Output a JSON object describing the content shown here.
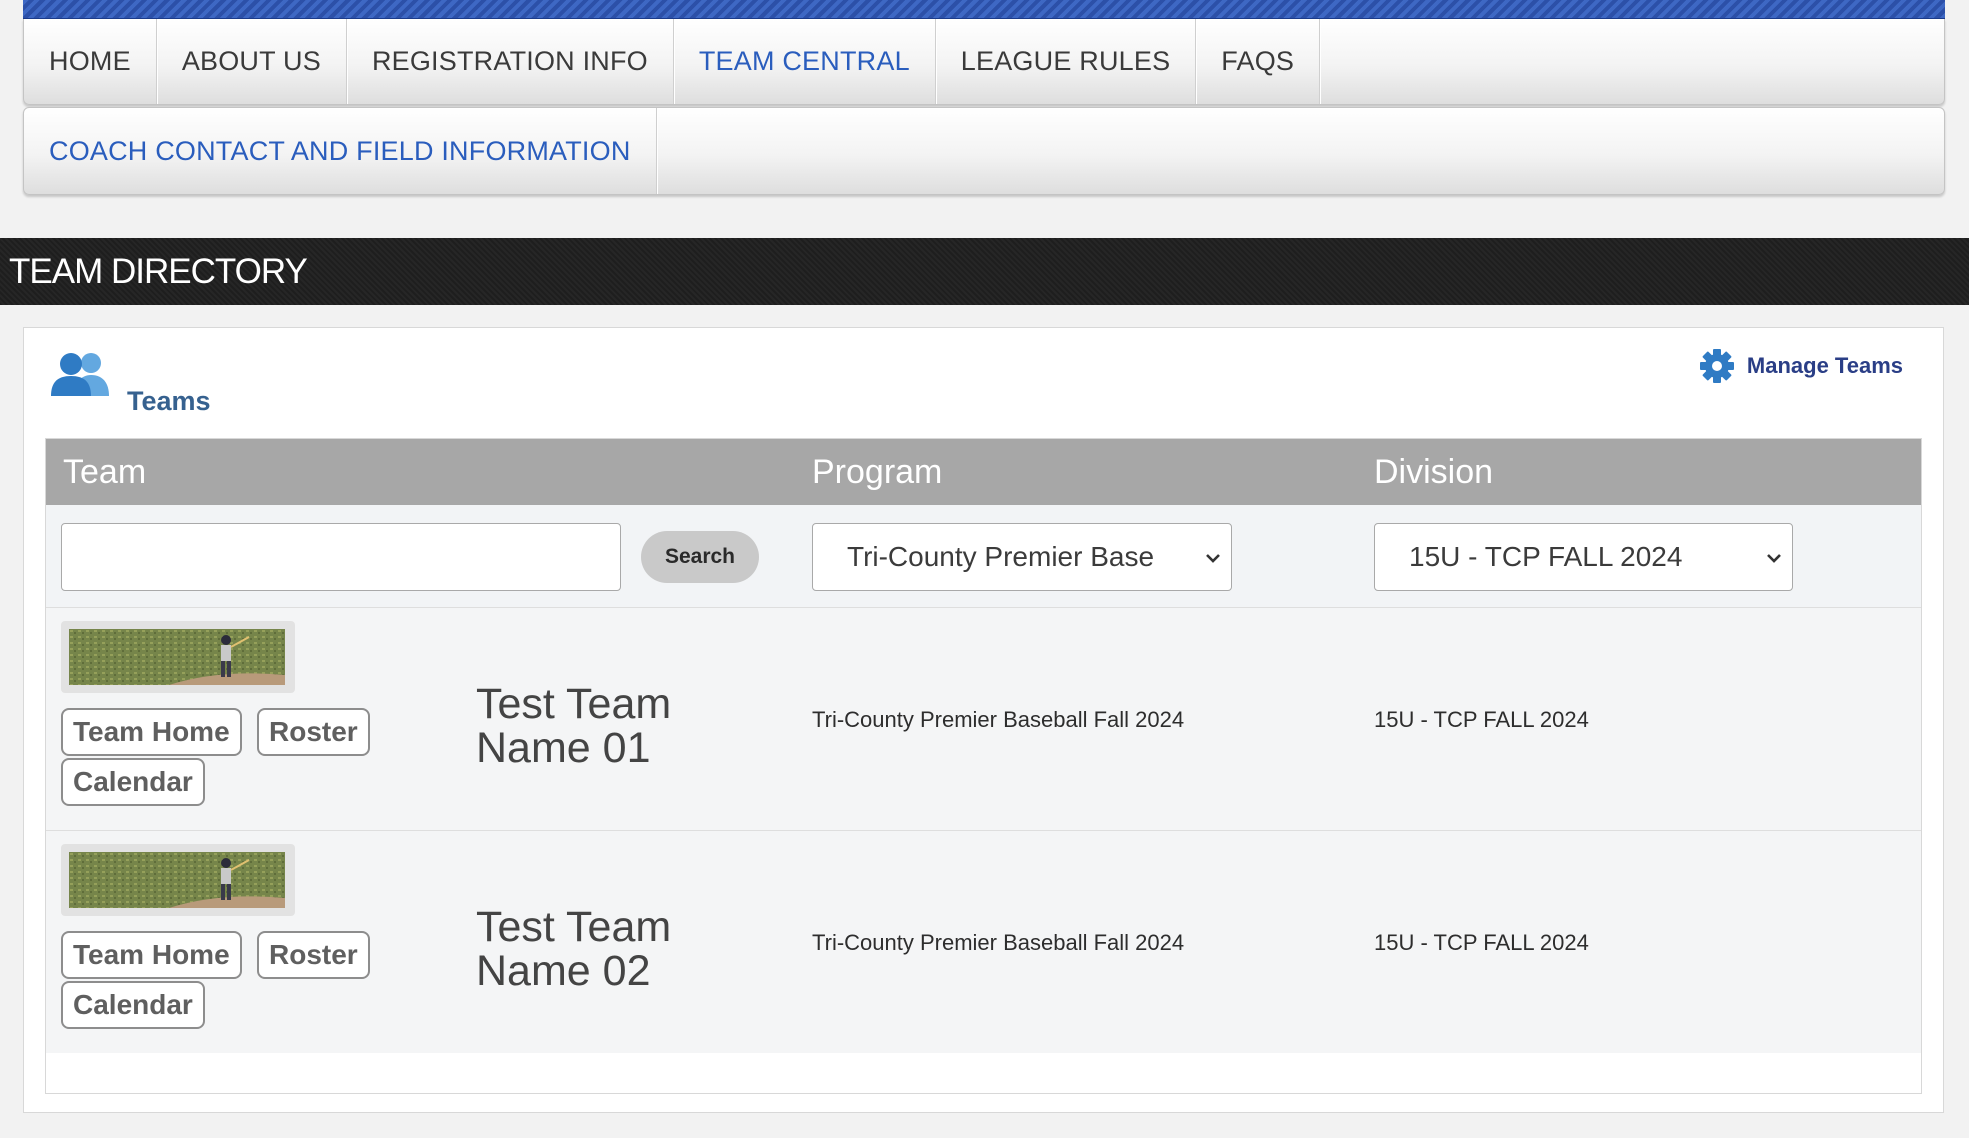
{
  "nav": {
    "row1": [
      "HOME",
      "ABOUT US",
      "REGISTRATION INFO",
      "TEAM CENTRAL",
      "LEAGUE RULES",
      "FAQS"
    ],
    "row2": [
      "COACH CONTACT AND FIELD INFORMATION"
    ],
    "active_color": "#2a5dbd"
  },
  "section": {
    "title": "TEAM DIRECTORY"
  },
  "panel": {
    "title": "Teams",
    "manage_label": "Manage Teams",
    "icons": {
      "teams": "users-icon",
      "manage": "gear-icon"
    }
  },
  "table": {
    "headers": {
      "team": "Team",
      "program": "Program",
      "division": "Division"
    },
    "search": {
      "value": "",
      "button_label": "Search"
    },
    "program_select": "Tri-County Premier Base",
    "division_select": "15U - TCP FALL 2024",
    "rows": [
      {
        "name": "Test Team Name 01",
        "program": "Tri-County Premier Baseball Fall 2024",
        "division": "15U - TCP FALL 2024",
        "buttons": {
          "home": "Team Home",
          "roster": "Roster",
          "calendar": "Calendar"
        }
      },
      {
        "name": "Test Team Name 02",
        "program": "Tri-County Premier Baseball Fall 2024",
        "division": "15U - TCP FALL 2024",
        "buttons": {
          "home": "Team Home",
          "roster": "Roster",
          "calendar": "Calendar"
        }
      }
    ]
  },
  "colors": {
    "header_bar": "#a7a7a7",
    "panel_title": "#36618f",
    "manage_link": "#2a3e86",
    "icon_blue": "#2f7bc4"
  }
}
